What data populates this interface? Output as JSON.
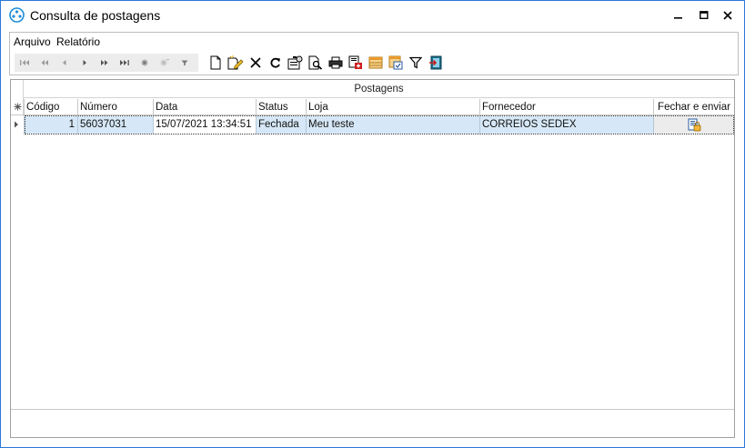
{
  "window": {
    "title": "Consulta de postagens",
    "accent": "#2b79d7"
  },
  "menu": {
    "items": [
      {
        "label": "Arquivo"
      },
      {
        "label": "Relatório"
      }
    ]
  },
  "toolbar": {
    "nav_buttons": [
      "first-icon",
      "prev-page-icon",
      "prev-icon",
      "next-icon",
      "next-page-icon",
      "last-icon",
      "insert-icon",
      "delete-icon",
      "filter-icon"
    ],
    "action_buttons": [
      "new-document-icon",
      "edit-document-icon",
      "delete-x-icon",
      "refresh-icon",
      "properties-icon",
      "preview-icon",
      "print-icon",
      "export-icon",
      "grid-icon",
      "layout-icon",
      "funnel-icon",
      "exit-icon"
    ]
  },
  "grid": {
    "band_title": "Postagens",
    "columns": [
      "Código",
      "Número",
      "Data",
      "Status",
      "Loja",
      "Fornecedor",
      "Fechar e enviar"
    ],
    "rows": [
      {
        "codigo": "1",
        "numero": "56037031",
        "data": "15/07/2021 13:34:51",
        "status": "Fechada",
        "loja": "Meu teste",
        "fornecedor": "CORREIOS SEDEX",
        "fechar_icon": "close-send-icon"
      }
    ],
    "selected_color": "#d6e8f7"
  }
}
